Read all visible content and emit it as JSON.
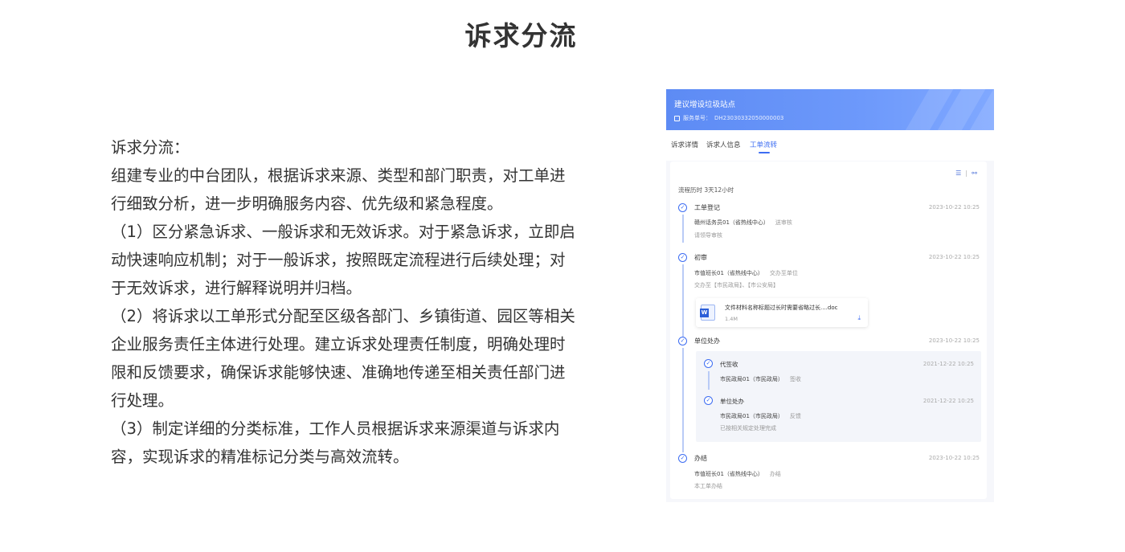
{
  "page_title": "诉求分流",
  "description": {
    "lines": [
      "诉求分流：",
      "组建专业的中台团队，根据诉求来源、类型和部门职责，对工单进",
      "行细致分析，进一步明确服务内容、优先级和紧急程度。",
      "（1）区分紧急诉求、一般诉求和无效诉求。对于紧急诉求，立即启",
      "动快速响应机制；对于一般诉求，按照既定流程进行后续处理；对",
      "于无效诉求，进行解释说明并归档。",
      "（2）将诉求以工单形式分配至区级各部门、乡镇街道、园区等相关",
      "企业服务责任主体进行处理。建立诉求处理责任制度，明确处理时",
      "限和反馈要求，确保诉求能够快速、准确地传递至相关责任部门进",
      "行处理。",
      "（3）制定详细的分类标准，工作人员根据诉求来源渠道与诉求内",
      "容，实现诉求的精准标记分类与高效流转。"
    ]
  },
  "phone": {
    "header_title": "建议增设垃圾站点",
    "service_no_label": "服务单号：",
    "service_no": "DH23030332050000003",
    "tabs": [
      "诉求详情",
      "诉求人信息",
      "工单流转"
    ],
    "active_tab": 2,
    "total_time": "流程历时 3天12小时",
    "steps": {
      "s1": {
        "title": "工单登记",
        "time": "2023-10-22 10:25",
        "actor": "赣州话务员01（省热线中心）",
        "action": "送审核",
        "note": "请领导审核"
      },
      "s2": {
        "title": "初审",
        "time": "2023-10-22 10:25",
        "actor": "市值班长01（省热线中心）",
        "action": "交办至单位",
        "note": "交办至【市民政局】、【市公安局】"
      },
      "attachment": {
        "name": "文件材料名称标题过长时需要省略过长....doc",
        "size": "1.4M"
      },
      "s3": {
        "title": "单位处办",
        "time": "2023-10-22 10:25"
      },
      "s3a": {
        "title": "代签收",
        "time": "2021-12-22 10:25",
        "actor": "市民政局01（市民政局）",
        "action": "签收"
      },
      "s3b": {
        "title": "单位处办",
        "time": "2021-12-22 10:25",
        "actor": "市民政局01（市民政局）",
        "action": "反馈",
        "note": "已按相关规定处理完成"
      },
      "s4": {
        "title": "办结",
        "time": "2023-10-22 10:25",
        "actor": "市值班长01（省热线中心）",
        "action": "办结",
        "note": "本工单办结"
      }
    },
    "icons": {
      "check": "✓",
      "list_view": "☰",
      "tree_view": "⚯",
      "download": "⤓",
      "word_doc": "W"
    },
    "colors": {
      "accent": "#3d6df2",
      "header": "#6d99fb"
    }
  }
}
